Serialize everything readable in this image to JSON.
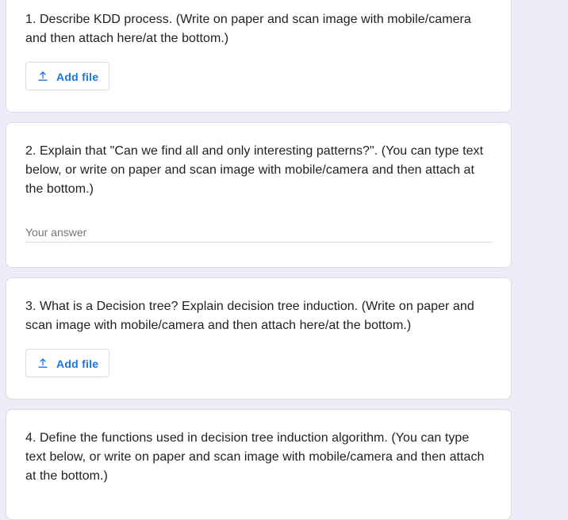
{
  "questions": [
    {
      "text": "1. Describe KDD process. (Write on paper and scan image with mobile/camera and then attach here/at the bottom.)",
      "action_label": "Add file",
      "action_icon": "upload-icon"
    },
    {
      "text": "2. Explain that \"Can we find all and only interesting patterns?\". (You can type text below, or write on paper and scan image with mobile/camera and then attach at the bottom.)",
      "answer_placeholder": "Your answer",
      "answer_value": ""
    },
    {
      "text": "3. What is a Decision tree? Explain decision tree induction. (Write on paper and scan image with mobile/camera and then attach here/at the bottom.)",
      "action_label": "Add file",
      "action_icon": "upload-icon"
    },
    {
      "text": "4. Define the functions used in decision tree induction algorithm. (You can type text below, or write on paper and scan image with mobile/camera and then attach at the bottom.)"
    }
  ],
  "colors": {
    "background": "#efebf8",
    "card": "#ffffff",
    "accent": "#1a73e8",
    "text": "#202124",
    "placeholder": "#70757a",
    "border": "#dadce0"
  }
}
